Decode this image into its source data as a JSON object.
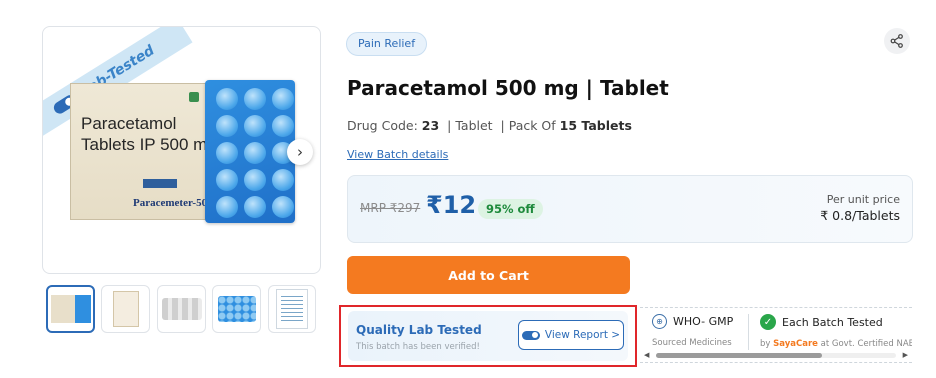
{
  "product_image": {
    "ribbon_text": "Lab-Tested",
    "box_text_line1": "Paracetamol",
    "box_text_line2": "Tablets IP 500 mg",
    "box_brand": "Paracemeter-500",
    "next_icon": "chevron-right-icon"
  },
  "thumbnails": [
    "box-front",
    "info-sheet",
    "strip-back",
    "blister-front",
    "document"
  ],
  "category_tag": "Pain Relief",
  "share_icon": "share-icon",
  "title": "Paracetamol 500 mg | Tablet",
  "specs": {
    "drug_code_label": "Drug Code:",
    "drug_code_value": "23",
    "form": "| Tablet",
    "pack_label": "| Pack Of",
    "pack_value": "15 Tablets"
  },
  "batch_link": "View Batch details",
  "price": {
    "mrp": "MRP ₹297",
    "price": "₹12",
    "discount": "95% off",
    "unit_label": "Per unit price",
    "unit_value": "₹ 0.8/Tablets"
  },
  "cart_button": "Add to Cart",
  "lab": {
    "title": "Quality Lab Tested",
    "subtitle": "This batch has been verified!",
    "report_button": "View Report >"
  },
  "badges": [
    {
      "title": "WHO- GMP",
      "subtitle": "Sourced Medicines",
      "icon": "globe-icon"
    },
    {
      "title": "Each Batch Tested",
      "subtitle_prefix": "by",
      "subtitle_brand": "SayaCare",
      "subtitle_suffix": "at Govt. Certified NABL",
      "icon": "check-icon"
    }
  ],
  "scroll": {
    "progress": 0.69
  },
  "colors": {
    "accent": "#2c6bb7",
    "cta": "#f47a20",
    "highlight_border": "#e0262a",
    "discount": "#1e8a3c"
  }
}
